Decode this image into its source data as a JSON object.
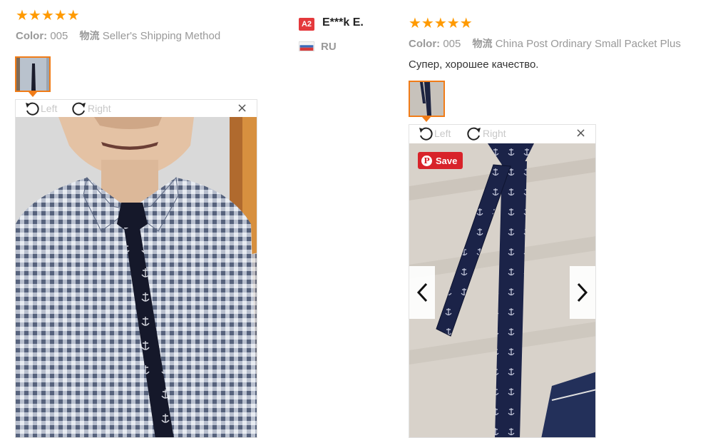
{
  "review_left": {
    "rating": "★★★★★",
    "color_label": "Color:",
    "color_value": "005",
    "shipping_label": "物流",
    "shipping_value": "Seller's Shipping Method",
    "viewer": {
      "rotate_left": "Left",
      "rotate_right": "Right",
      "close": "×"
    }
  },
  "review_right": {
    "author_badge": "A2",
    "author_name": "E***k E.",
    "country": "RU",
    "rating": "★★★★★",
    "color_label": "Color:",
    "color_value": "005",
    "shipping_label": "物流",
    "shipping_value": "China Post Ordinary Small Packet Plus",
    "text": "Супер, хорошее качество.",
    "viewer": {
      "rotate_left": "Left",
      "rotate_right": "Right",
      "close": "×",
      "save_label": "Save"
    }
  },
  "colors": {
    "star": "#ff9a00",
    "thumb_border": "#f07c18",
    "badge": "#e4393c",
    "save": "#d8232a"
  }
}
